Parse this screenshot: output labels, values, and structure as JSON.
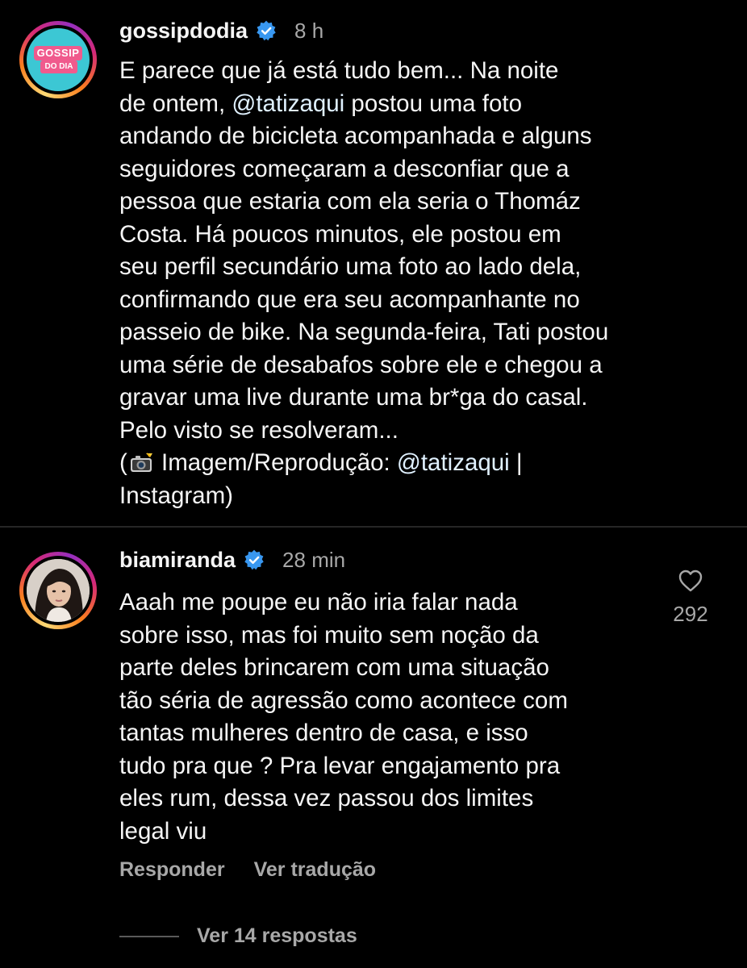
{
  "caption": {
    "username": "gossipdodia",
    "timestamp": "8 h",
    "avatar_logo": {
      "top": "GOSSIP",
      "bottom": "DO DIA"
    },
    "lines": [
      {
        "text": "E parece que já está tudo bem... Na noite"
      },
      {
        "pre": "de ontem, ",
        "mention": "@tatizaqui",
        "post": " postou uma foto"
      },
      {
        "text": "andando de bicicleta acompanhada e alguns"
      },
      {
        "text": "seguidores começaram a desconfiar que a"
      },
      {
        "text": "pessoa que estaria com ela seria o Thomáz"
      },
      {
        "text": "Costa. Há poucos minutos, ele postou em"
      },
      {
        "text": "seu perfil secundário uma foto ao lado dela,"
      },
      {
        "text": "confirmando que era seu acompanhante no"
      },
      {
        "text": "passeio de bike. Na segunda-feira, Tati postou"
      },
      {
        "text": "uma série de desabafos sobre ele e chegou a"
      },
      {
        "text": "gravar uma live durante uma br*ga do casal."
      },
      {
        "text": "Pelo visto se resolveram..."
      },
      {
        "pre": "(",
        "icon": "camera-flash-icon",
        "mid": " Imagem/Reprodução: ",
        "mention": "@tatizaqui",
        "post": " |"
      },
      {
        "text": "Instagram)"
      }
    ]
  },
  "comment": {
    "username": "biamiranda",
    "timestamp": "28 min",
    "likes": "292",
    "lines": [
      "Aaah me poupe eu não iria falar nada",
      "sobre isso, mas foi muito sem noção da",
      "parte deles brincarem com uma situação",
      "tão séria de agressão como acontece com",
      "tantas mulheres dentro de casa, e isso",
      "tudo pra que ? Pra levar engajamento pra",
      "eles rum, dessa vez passou dos limites",
      "legal viu"
    ],
    "reply_label": "Responder",
    "translate_label": "Ver tradução",
    "view_replies_label": "Ver 14 respostas"
  },
  "colors": {
    "background": "#000000",
    "text": "#f5f5f5",
    "secondary": "#a8a8a8",
    "verified": "#3897f0",
    "mention": "#e0f1ff"
  },
  "icons": [
    "verified-badge-icon",
    "heart-icon",
    "camera-flash-icon"
  ]
}
